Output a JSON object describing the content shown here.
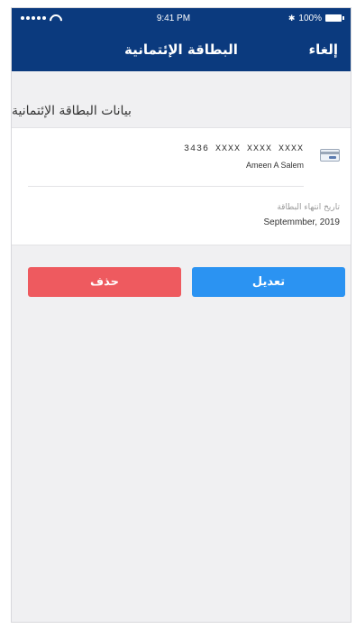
{
  "status_bar": {
    "time": "9:41 PM",
    "battery": "100%"
  },
  "nav": {
    "title": "البطاقة الإئتمانية",
    "cancel_label": "إلغاء"
  },
  "section": {
    "header": "بيانات البطاقة الإئتمانية"
  },
  "card": {
    "number": "3436 XXXX XXXX XXXX",
    "holder": "Ameen A Salem",
    "icon": "credit-card-icon"
  },
  "expiry": {
    "label": "تاريخ انتهاء البطاقة",
    "value": "Septemmber, 2019"
  },
  "actions": {
    "edit_label": "تعديل",
    "delete_label": "حذف"
  },
  "colors": {
    "navbar": "#0b3a7e",
    "edit_button": "#2b93f2",
    "delete_button": "#ee5a5f",
    "background": "#f0f0f2"
  }
}
